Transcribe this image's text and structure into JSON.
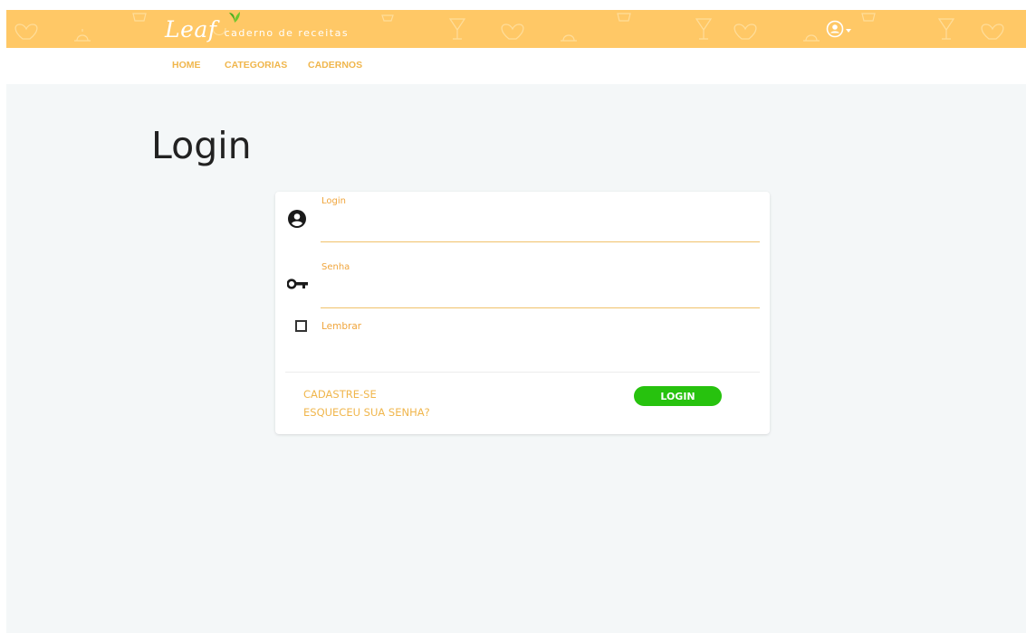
{
  "app": {
    "brand": "Leaf",
    "tagline": "caderno de receitas",
    "header_color": "#ffc866",
    "accent_color": "#f0b64c",
    "leaf_color": "#4caf1f"
  },
  "nav": {
    "items": [
      {
        "label": "HOME"
      },
      {
        "label": "CATEGORIAS"
      },
      {
        "label": "CADERNOS"
      }
    ]
  },
  "account": {
    "icon": "account-circle-icon",
    "dropdown_icon": "caret-down-icon"
  },
  "page": {
    "title": "Login"
  },
  "form": {
    "login": {
      "label": "Login",
      "value": "",
      "icon": "account-circle-icon"
    },
    "password": {
      "label": "Senha",
      "value": "",
      "icon": "key-icon"
    },
    "remember": {
      "label": "Lembrar",
      "checked": false
    },
    "register_link": "CADASTRE-SE",
    "forgot_link": "ESQUECEU SUA SENHA?",
    "submit_label": "LOGIN",
    "submit_color": "#27c20e"
  }
}
